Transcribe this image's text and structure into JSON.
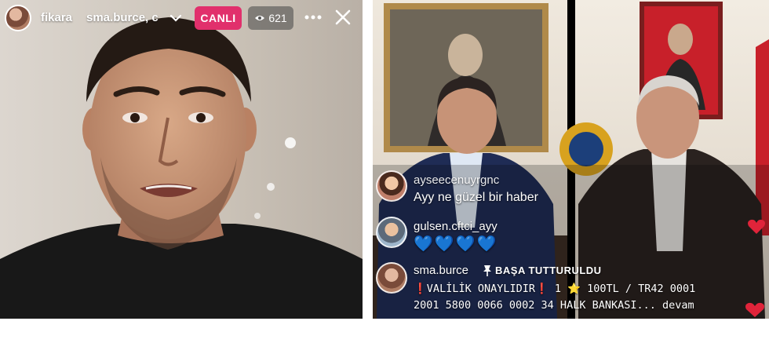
{
  "left_stream": {
    "host_username": "fikara",
    "guest_username": "sma.burce, c",
    "live_label": "CANLI",
    "viewer_count": "621",
    "icons": [
      "host-avatar-icon",
      "chevron-down-icon",
      "eye-icon",
      "more-icon",
      "close-icon"
    ]
  },
  "right_stream": {
    "comments": [
      {
        "username": "ayseecenuyrgnc",
        "message": "Ayy ne güzel bir haber"
      },
      {
        "username": "gulsen.cftci_ayy",
        "message": "💙💙💙💙"
      }
    ],
    "pinned": {
      "username": "sma.burce",
      "pin_label": "BAŞA TUTTURULDU",
      "line1": "❗VALİLİK ONAYLIDIR❗ 1 ⭐ 100TL / TR42 0001",
      "line2": "2001 5800 0066 0002 34  HALK BANKASI... devam"
    },
    "icons": [
      "pin-icon",
      "heart-icon",
      "heart-icon"
    ]
  },
  "colors": {
    "live": "#e1306c",
    "heart": "#e0243a"
  }
}
